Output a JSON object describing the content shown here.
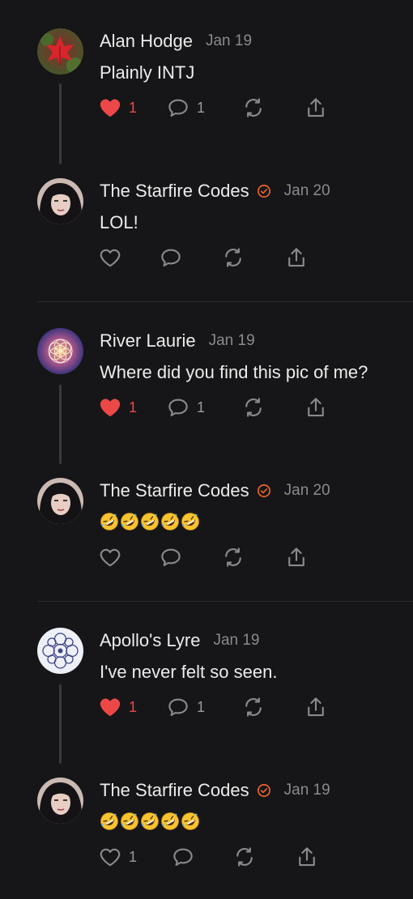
{
  "colors": {
    "background": "#161618",
    "text": "#ececec",
    "muted": "#8a8a8e",
    "like": "#ec4848",
    "verified": "#f0642d"
  },
  "threads": [
    {
      "comment": {
        "author": "Alan Hodge",
        "date": "Jan 19",
        "text": "Plainly INTJ",
        "avatar_icon": "red-leaf-avatar",
        "likes": "1",
        "replies": "1",
        "liked": true
      },
      "reply": {
        "author": "The Starfire Codes",
        "verified": true,
        "date": "Jan 20",
        "text": "LOL!",
        "avatar_icon": "portrait-avatar",
        "likes": "",
        "replies": ""
      }
    },
    {
      "comment": {
        "author": "River Laurie",
        "date": "Jan 19",
        "text": "Where did you find this pic of me?",
        "avatar_icon": "flower-of-life-avatar",
        "likes": "1",
        "replies": "1",
        "liked": true
      },
      "reply": {
        "author": "The Starfire Codes",
        "verified": true,
        "date": "Jan 20",
        "emoji_count": 5,
        "emoji_icon": "rolling-on-floor-laughing-emoji",
        "avatar_icon": "portrait-avatar",
        "likes": "",
        "replies": ""
      }
    },
    {
      "comment": {
        "author": "Apollo's Lyre",
        "date": "Jan 19",
        "text": "I've never felt so seen.",
        "avatar_icon": "mandala-avatar",
        "likes": "1",
        "replies": "1",
        "liked": true
      },
      "reply": {
        "author": "The Starfire Codes",
        "verified": true,
        "date": "Jan 19",
        "emoji_count": 5,
        "emoji_icon": "rolling-on-floor-laughing-emoji",
        "avatar_icon": "portrait-avatar",
        "likes": "1",
        "replies": "",
        "liked": false
      }
    }
  ]
}
